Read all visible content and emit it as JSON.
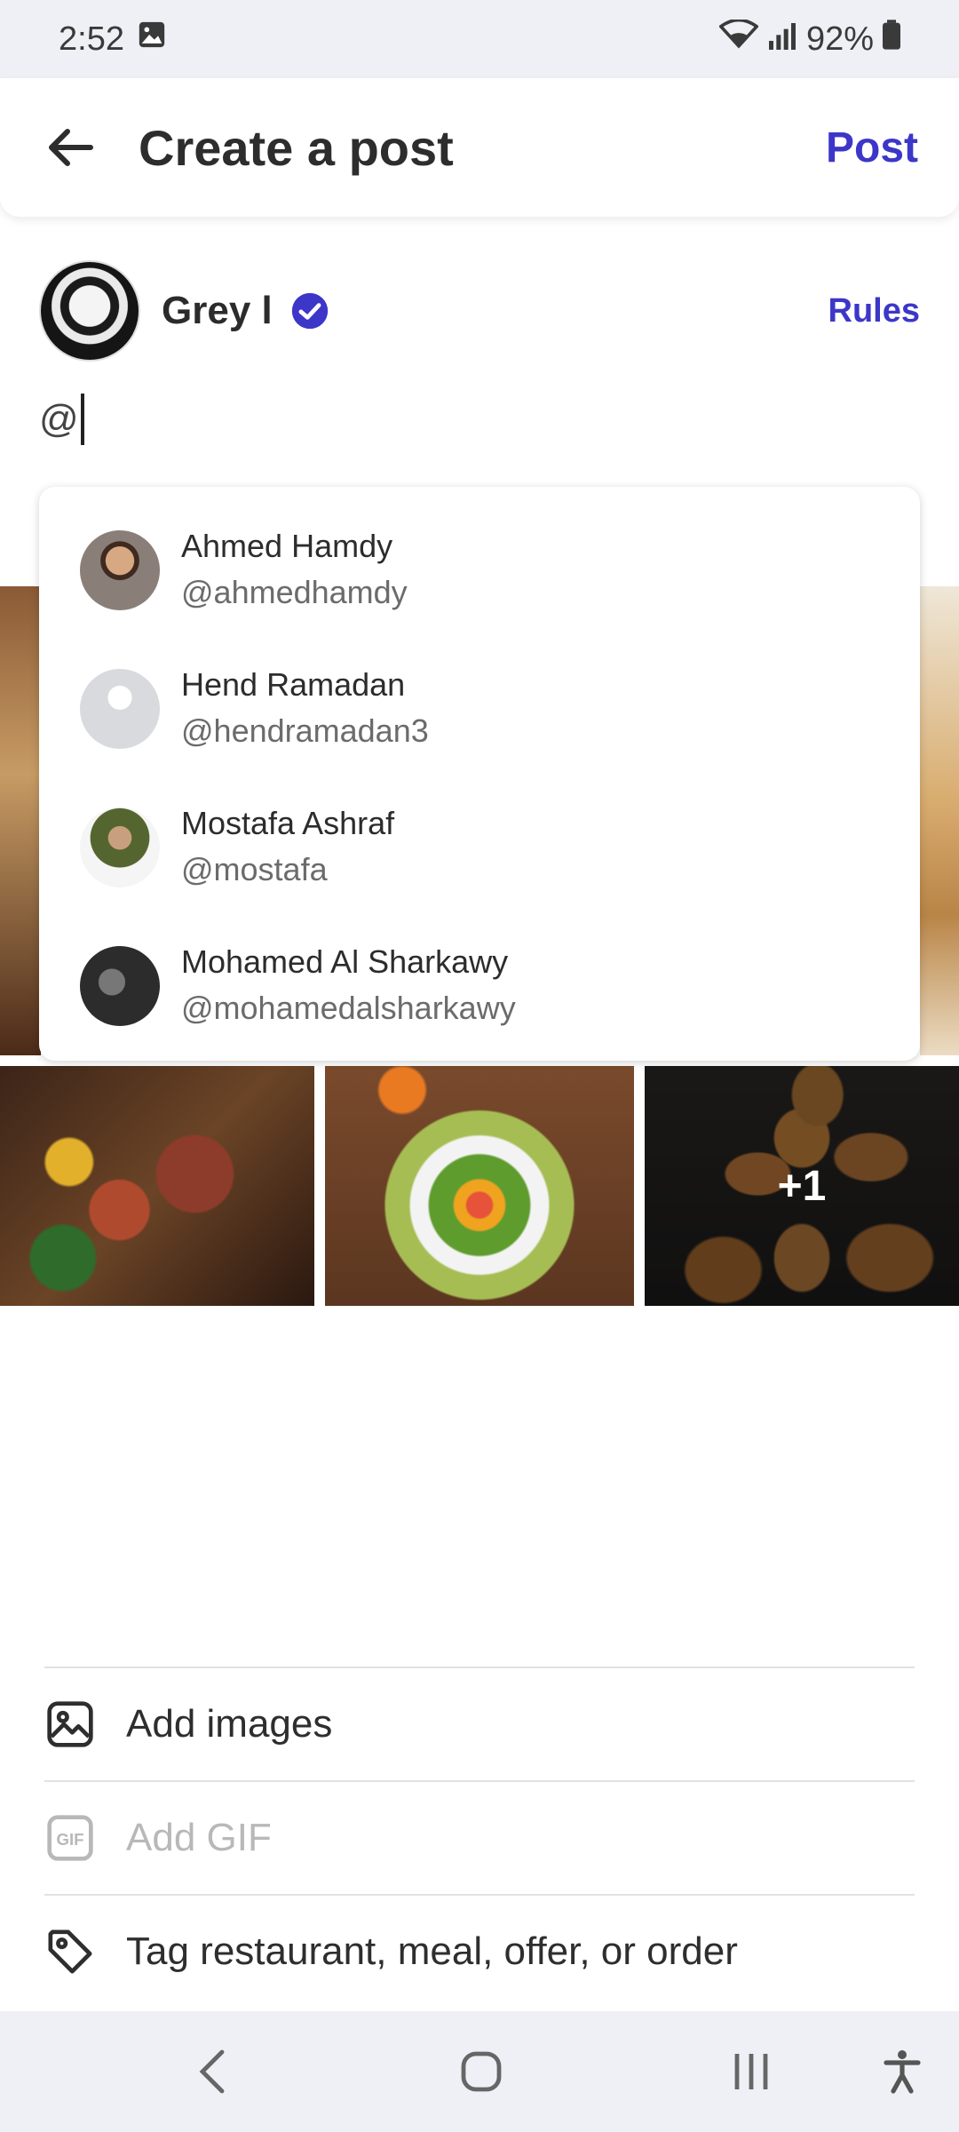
{
  "status_bar": {
    "time": "2:52",
    "battery": "92%",
    "icons": [
      "gallery-notification-icon",
      "wifi-icon",
      "signal-icon",
      "battery-icon"
    ]
  },
  "header": {
    "title": "Create a post",
    "post_label": "Post",
    "accent_color": "#3c37c8"
  },
  "author": {
    "name": "Grey l",
    "rules_label": "Rules"
  },
  "composer": {
    "text": "@"
  },
  "mentions": [
    {
      "name": "Ahmed Hamdy",
      "handle": "@ahmedhamdy"
    },
    {
      "name": "Hend Ramadan",
      "handle": "@hendramadan3"
    },
    {
      "name": "Mostafa Ashraf",
      "handle": "@mostafa"
    },
    {
      "name": "Mohamed Al Sharkawy",
      "handle": "@mohamedalsharkawy"
    }
  ],
  "images": {
    "more_count": "+1"
  },
  "actions": [
    {
      "label": "Add images",
      "icon": "image-icon",
      "enabled": true
    },
    {
      "label": "Add GIF",
      "icon": "gif-icon",
      "enabled": false
    },
    {
      "label": "Tag restaurant, meal, offer, or order",
      "icon": "tag-icon",
      "enabled": true
    }
  ],
  "nav_bar": {
    "icons": [
      "back-nav-icon",
      "home-nav-icon",
      "recents-nav-icon",
      "accessibility-icon"
    ]
  }
}
